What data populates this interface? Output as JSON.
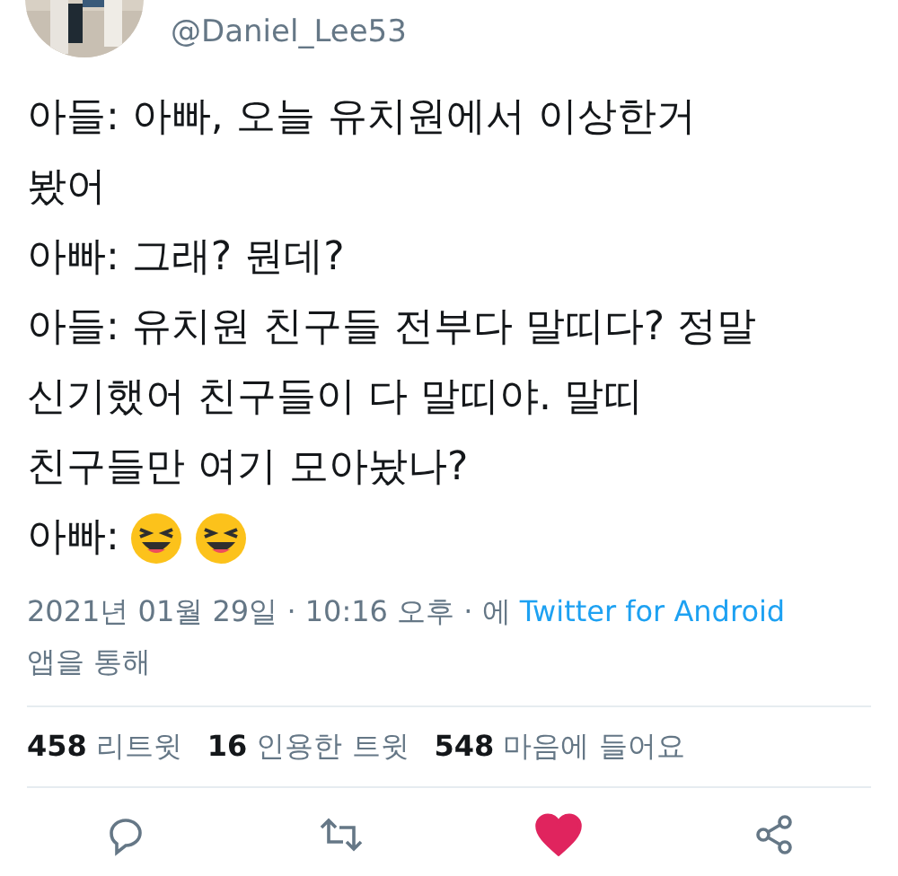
{
  "author": {
    "handle": "@Daniel_Lee53"
  },
  "tweet": {
    "paragraphs": [
      "아들: 아빠, 오늘 유치원에서 이상한거 봤어",
      "아빠: 그래? 뭔데?",
      "아들: 유치원 친구들 전부다 말띠다? 정말 신기했어 친구들이 다 말띠야. 말띠 친구들만 여기 모아놨나?"
    ],
    "last_line": {
      "speaker": "아빠:",
      "emoji": [
        {
          "kind": "laughing"
        },
        {
          "kind": "laughing"
        }
      ]
    }
  },
  "meta": {
    "date": "2021년 01월 29일 · 10:16 오후 · 에",
    "source": "Twitter for Android",
    "suffix": "앱을 통해"
  },
  "stats": [
    {
      "count": "458",
      "label": "리트윗"
    },
    {
      "count": "16",
      "label": "인용한 트윗"
    },
    {
      "count": "548",
      "label": "마음에 들어요"
    }
  ],
  "actions": {
    "liked": true
  }
}
